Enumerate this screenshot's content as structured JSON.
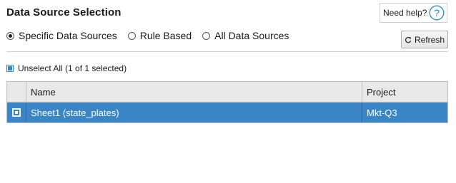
{
  "header": {
    "title": "Data Source Selection",
    "help_label": "Need help?",
    "help_symbol": "?"
  },
  "selection_mode": {
    "options": [
      {
        "label": "Specific Data Sources",
        "selected": true
      },
      {
        "label": "Rule Based",
        "selected": false
      },
      {
        "label": "All Data Sources",
        "selected": false
      }
    ]
  },
  "toolbar": {
    "refresh_label": "Refresh"
  },
  "bulk": {
    "unselect_label": "Unselect All (1 of 1 selected)"
  },
  "table": {
    "columns": [
      "Name",
      "Project"
    ],
    "rows": [
      {
        "name": "Sheet1 (state_plates)",
        "project": "Mkt-Q3",
        "checked": true,
        "highlighted": true
      }
    ]
  },
  "colors": {
    "accent": "#3a85c6",
    "help_icon": "#2a86d3",
    "header_bg": "#e8e8e8"
  }
}
